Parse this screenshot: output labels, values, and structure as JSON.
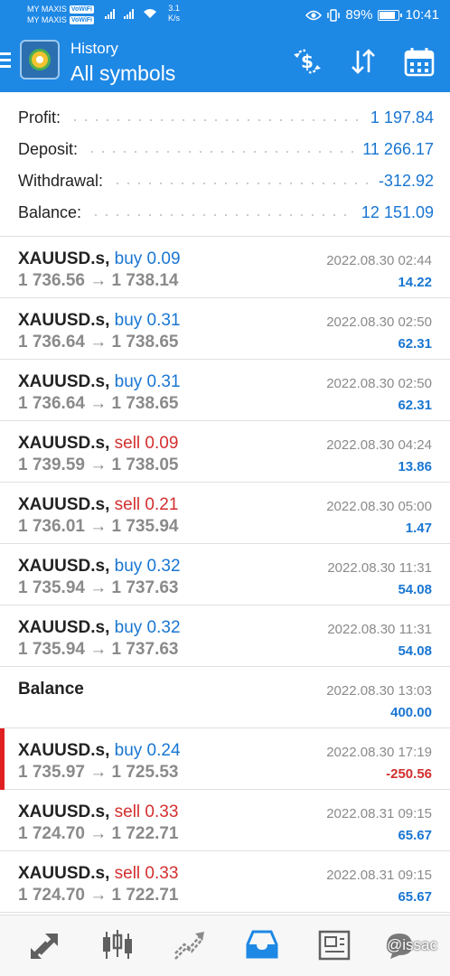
{
  "status_bar": {
    "carrier_1": "MY MAXIS",
    "carrier_2": "MY MAXIS",
    "vowifi_badge": "VoWiFi",
    "speed_value": "3.1",
    "speed_unit": "K/s",
    "battery": "89%",
    "battery_level": 0.89,
    "time": "10:41"
  },
  "appbar": {
    "subtitle": "History",
    "title": "All symbols",
    "icons": [
      "currency-exchange-icon",
      "sort-icon",
      "calendar-icon"
    ]
  },
  "summary": [
    {
      "label": "Profit:",
      "value": "1 197.84"
    },
    {
      "label": "Deposit:",
      "value": "11 266.17"
    },
    {
      "label": "Withdrawal:",
      "value": "-312.92"
    },
    {
      "label": "Balance:",
      "value": "12 151.09"
    }
  ],
  "deals": [
    {
      "symbol": "XAUUSD.s,",
      "direction": "buy 0.09",
      "side": "buy",
      "prices": "1 736.56 → 1 738.14",
      "time": "2022.08.30 02:44",
      "profit": "14.22",
      "negative": false
    },
    {
      "symbol": "XAUUSD.s,",
      "direction": "buy 0.31",
      "side": "buy",
      "prices": "1 736.64 → 1 738.65",
      "time": "2022.08.30 02:50",
      "profit": "62.31",
      "negative": false
    },
    {
      "symbol": "XAUUSD.s,",
      "direction": "buy 0.31",
      "side": "buy",
      "prices": "1 736.64 → 1 738.65",
      "time": "2022.08.30 02:50",
      "profit": "62.31",
      "negative": false
    },
    {
      "symbol": "XAUUSD.s,",
      "direction": "sell 0.09",
      "side": "sell",
      "prices": "1 739.59 → 1 738.05",
      "time": "2022.08.30 04:24",
      "profit": "13.86",
      "negative": false
    },
    {
      "symbol": "XAUUSD.s,",
      "direction": "sell 0.21",
      "side": "sell",
      "prices": "1 736.01 → 1 735.94",
      "time": "2022.08.30 05:00",
      "profit": "1.47",
      "negative": false
    },
    {
      "symbol": "XAUUSD.s,",
      "direction": "buy 0.32",
      "side": "buy",
      "prices": "1 735.94 → 1 737.63",
      "time": "2022.08.30 11:31",
      "profit": "54.08",
      "negative": false
    },
    {
      "symbol": "XAUUSD.s,",
      "direction": "buy 0.32",
      "side": "buy",
      "prices": "1 735.94 → 1 737.63",
      "time": "2022.08.30 11:31",
      "profit": "54.08",
      "negative": false
    },
    {
      "symbol": "Balance",
      "direction": "",
      "side": "",
      "prices": "",
      "time": "2022.08.30 13:03",
      "profit": "400.00",
      "negative": false
    },
    {
      "symbol": "XAUUSD.s,",
      "direction": "buy 0.24",
      "side": "buy",
      "prices": "1 735.97 → 1 725.53",
      "time": "2022.08.30 17:19",
      "profit": "-250.56",
      "negative": true,
      "loss_marker": true
    },
    {
      "symbol": "XAUUSD.s,",
      "direction": "sell 0.33",
      "side": "sell",
      "prices": "1 724.70 → 1 722.71",
      "time": "2022.08.31 09:15",
      "profit": "65.67",
      "negative": false
    },
    {
      "symbol": "XAUUSD.s,",
      "direction": "sell 0.33",
      "side": "sell",
      "prices": "1 724.70 → 1 722.71",
      "time": "2022.08.31 09:15",
      "profit": "65.67",
      "negative": false
    }
  ],
  "bottom_nav": {
    "items": [
      "quotes-icon",
      "chart-icon",
      "trade-icon",
      "history-icon",
      "news-icon",
      "chat-icon"
    ],
    "active": "history-icon"
  },
  "watermark": "@issac",
  "colors": {
    "accent": "#1e88e5",
    "positive": "#1976d2",
    "negative": "#d32f2f",
    "muted": "#8a8a8a"
  }
}
